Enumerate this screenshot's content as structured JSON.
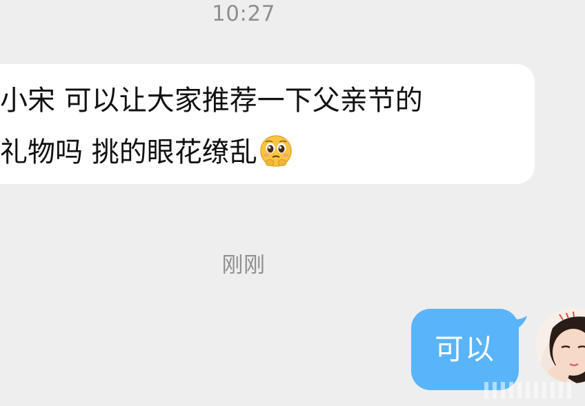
{
  "chat": {
    "timestamp_top": "10:27",
    "incoming_message": {
      "line_1": "小宋 可以让大家推荐一下父亲节的",
      "line_2": "礼物吗  挑的眼花缭乱",
      "emoji": "pleading-face"
    },
    "timestamp_bottom": "刚刚",
    "outgoing_message": {
      "text": "可以"
    }
  },
  "colors": {
    "background": "#eeeeee",
    "incoming_bubble": "#ffffff",
    "outgoing_bubble": "#5ab4f9",
    "timestamp_text": "#8f8f8f"
  },
  "icons": {
    "avatar": "user-avatar",
    "watermark": "watermark-icon"
  }
}
